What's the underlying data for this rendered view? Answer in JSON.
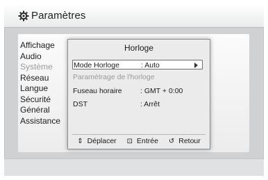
{
  "header": {
    "title": "Paramètres",
    "icon": "gear-icon"
  },
  "sidebar": {
    "items": [
      {
        "label": "Affichage"
      },
      {
        "label": "Audio"
      },
      {
        "label": "Système"
      },
      {
        "label": "Réseau"
      },
      {
        "label": "Langue"
      },
      {
        "label": "Sécurité"
      },
      {
        "label": "Général"
      },
      {
        "label": "Assistance"
      }
    ]
  },
  "popup": {
    "title": "Horloge",
    "rows": [
      {
        "label": "Mode Horloge",
        "value": ": Auto"
      },
      {
        "label": "Paramétrage de l'horloge",
        "value": ""
      },
      {
        "label": "Fuseau horaire",
        "value": ": GMT + 0:00"
      },
      {
        "label": "DST",
        "value": ": Arrêt"
      }
    ],
    "help": {
      "move": "Déplacer",
      "enter": "Entrée",
      "back": "Retour",
      "move_icon": "updown-icon",
      "enter_icon": "enter-icon",
      "back_icon": "return-icon"
    }
  }
}
